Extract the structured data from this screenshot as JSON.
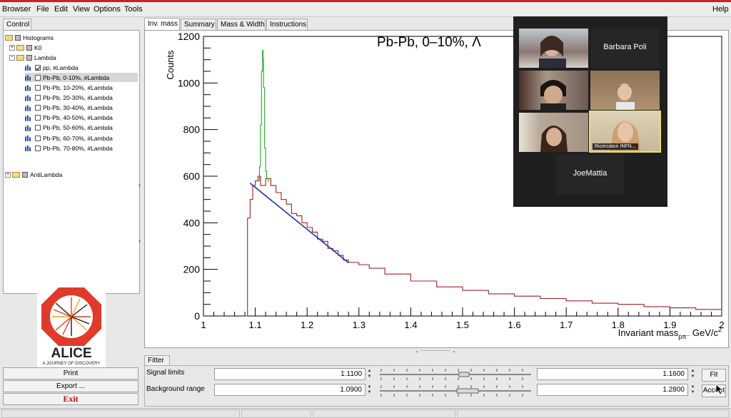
{
  "menu": {
    "browser": "Browser",
    "file": "File",
    "edit": "Edit",
    "view": "View",
    "options": "Options",
    "tools": "Tools",
    "help": "Help"
  },
  "left": {
    "control_tab": "Control",
    "tree": [
      {
        "label": "Histograms",
        "type": "root"
      },
      {
        "label": "K0",
        "type": "folder"
      },
      {
        "label": "Lambda",
        "type": "folder"
      },
      {
        "label": "pp, #Lambda",
        "type": "hist",
        "checked": true
      },
      {
        "label": "Pb-Pb, 0-10%, #Lambda",
        "type": "hist",
        "selected": true
      },
      {
        "label": "Pb-Pb, 10-20%, #Lambda",
        "type": "hist"
      },
      {
        "label": "Pb-Pb, 20-30%, #Lambda",
        "type": "hist"
      },
      {
        "label": "Pb-Pb, 30-40%, #Lambda",
        "type": "hist"
      },
      {
        "label": "Pb-Pb, 40-50%, #Lambda",
        "type": "hist"
      },
      {
        "label": "Pb-Pb, 50-60%, #Lambda",
        "type": "hist"
      },
      {
        "label": "Pb-Pb, 60-70%, #Lambda",
        "type": "hist"
      },
      {
        "label": "Pb-Pb, 70-80%, #Lambda",
        "type": "hist"
      },
      {
        "label": "AntiLambda",
        "type": "folder"
      }
    ],
    "logo_text": "ALICE",
    "logo_sub": "A JOURNEY OF DISCOVERY",
    "print": "Print",
    "export": "Export ...",
    "exit": "Exit"
  },
  "tabs": [
    "Inv. mass",
    "Summary",
    "Mass & Width",
    "Instructions"
  ],
  "chart_data": {
    "type": "line",
    "title": "Pb-Pb, 0–10%, Λ",
    "ylabel": "Counts",
    "xlabel": "Invariant mass",
    "xlabel_sub": "pπ⁻",
    "xlabel_unit": "GeV/c",
    "xlabel_unit_sup": "2",
    "xlim": [
      1.0,
      2.0
    ],
    "ylim": [
      0,
      1200
    ],
    "xticks": [
      "1",
      "1.1",
      "1.2",
      "1.3",
      "1.4",
      "1.5",
      "1.6",
      "1.7",
      "1.8",
      "1.9",
      "2"
    ],
    "yticks": [
      "0",
      "200",
      "400",
      "600",
      "800",
      "1000",
      "1200"
    ],
    "series": [
      {
        "name": "",
        "color": "#a02020",
        "x": [
          1.08,
          1.085,
          1.09,
          1.095,
          1.1,
          1.105,
          1.11,
          1.12,
          1.13,
          1.14,
          1.15,
          1.16,
          1.17,
          1.18,
          1.19,
          1.2,
          1.21,
          1.22,
          1.23,
          1.24,
          1.25,
          1.26,
          1.27,
          1.28,
          1.3,
          1.32,
          1.35,
          1.4,
          1.45,
          1.5,
          1.55,
          1.6,
          1.65,
          1.7,
          1.75,
          1.8,
          1.85,
          1.9,
          1.95,
          2.0
        ],
        "y": [
          0,
          420,
          500,
          560,
          580,
          600,
          560,
          590,
          560,
          530,
          500,
          480,
          440,
          430,
          400,
          380,
          360,
          330,
          320,
          290,
          280,
          260,
          240,
          230,
          220,
          205,
          180,
          150,
          125,
          110,
          95,
          85,
          75,
          65,
          55,
          50,
          40,
          35,
          28,
          20
        ]
      },
      {
        "name": "",
        "color": "#22aa22",
        "x": [
          1.105,
          1.108,
          1.11,
          1.112,
          1.114,
          1.115,
          1.116,
          1.118,
          1.12,
          1.122,
          1.125
        ],
        "y": [
          580,
          640,
          820,
          1050,
          1140,
          1100,
          980,
          720,
          620,
          590,
          575
        ]
      },
      {
        "name": "",
        "color": "#1f2fb0",
        "x": [
          1.09,
          1.28
        ],
        "y": [
          570,
          228
        ]
      }
    ]
  },
  "fitter": {
    "tab": "Fitter",
    "signal_label": "Signal limits",
    "bg_label": "Background range",
    "signal_lo": "1.1100",
    "signal_hi": "1.1600",
    "bg_lo": "1.0900",
    "bg_hi": "1.2800",
    "fit": "Fit",
    "accept": "Accept"
  },
  "video": {
    "names": [
      "Barbara Poli",
      "JoeMattia"
    ],
    "tag": "Ricercatori INFN..."
  }
}
